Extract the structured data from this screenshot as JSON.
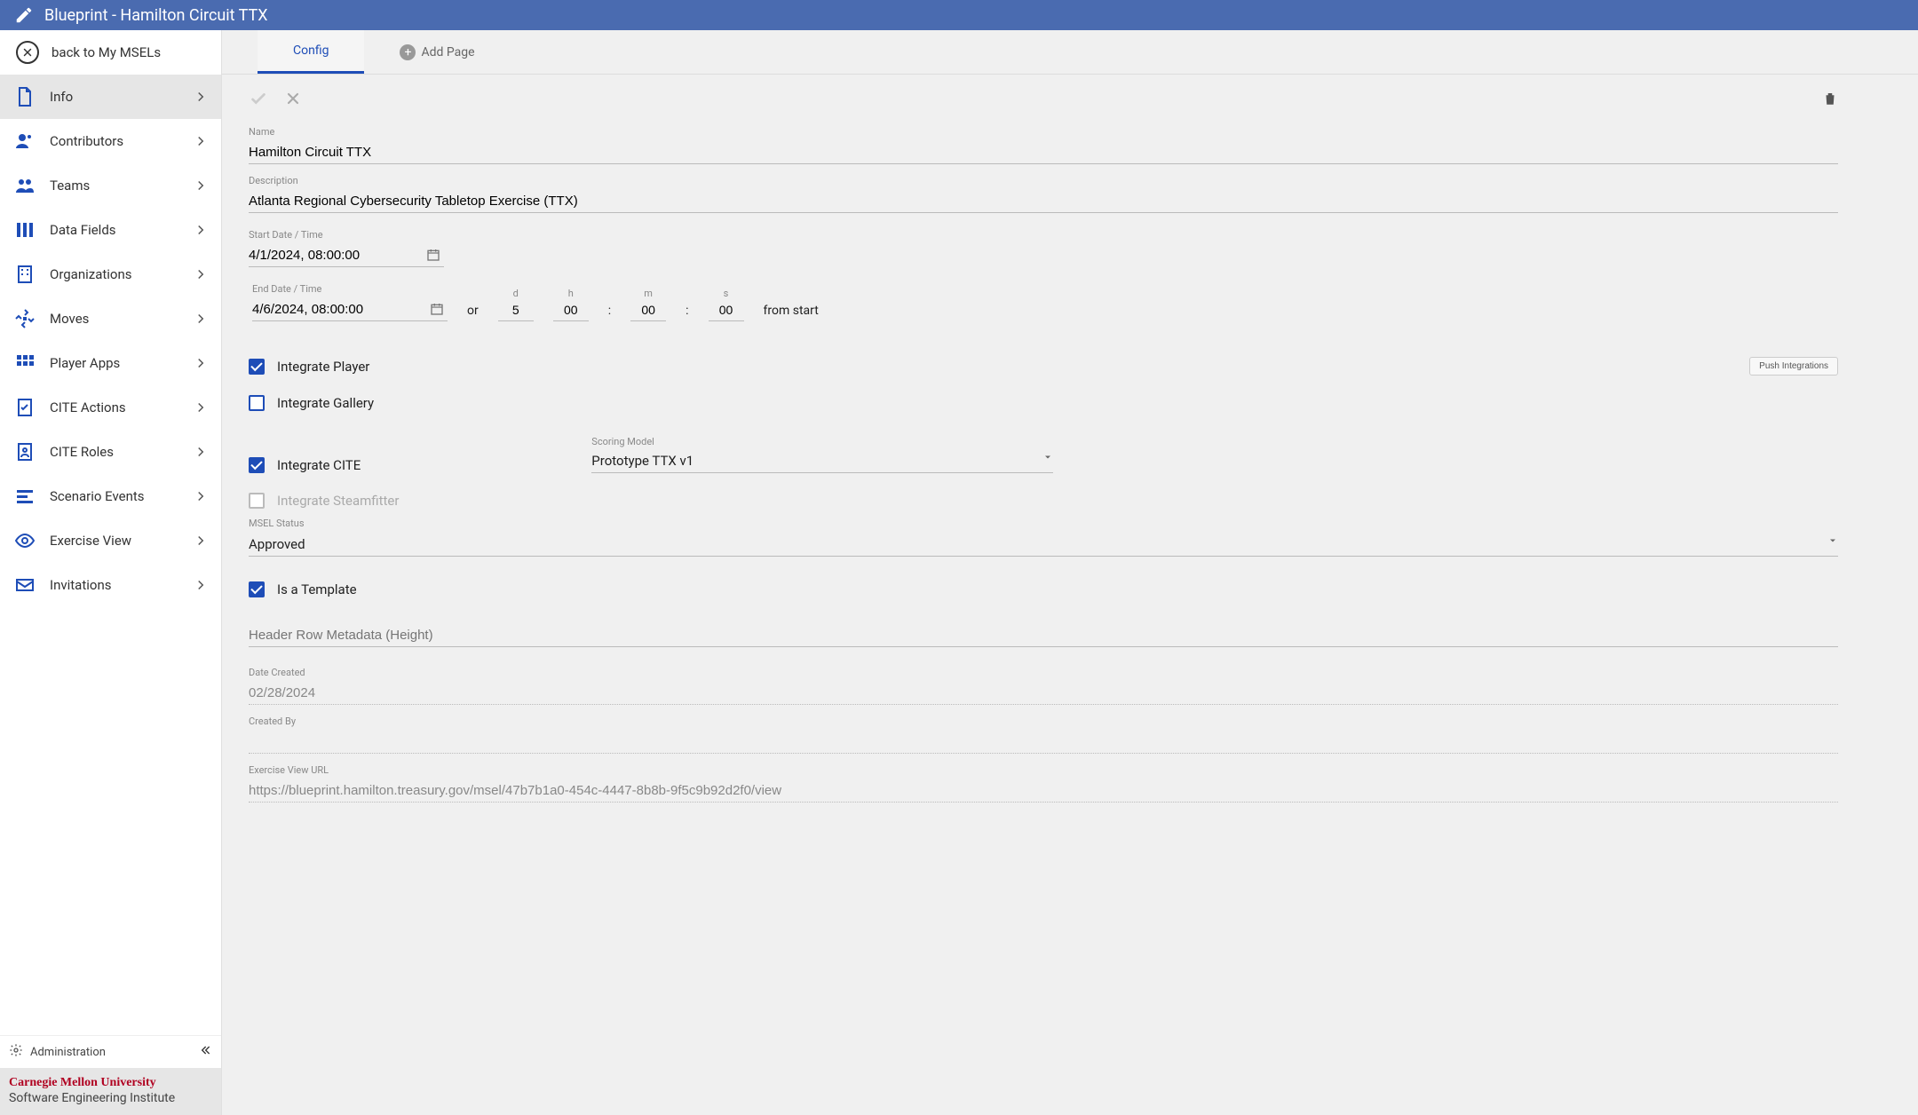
{
  "header": {
    "title": "Blueprint - Hamilton Circuit TTX"
  },
  "sidebar": {
    "back_label": "back to My MSELs",
    "items": [
      {
        "key": "info",
        "label": "Info",
        "active": true
      },
      {
        "key": "contributors",
        "label": "Contributors"
      },
      {
        "key": "teams",
        "label": "Teams"
      },
      {
        "key": "datafields",
        "label": "Data Fields"
      },
      {
        "key": "organizations",
        "label": "Organizations"
      },
      {
        "key": "moves",
        "label": "Moves"
      },
      {
        "key": "playerapps",
        "label": "Player Apps"
      },
      {
        "key": "citeactions",
        "label": "CITE Actions"
      },
      {
        "key": "citeroles",
        "label": "CITE Roles"
      },
      {
        "key": "scenarioevents",
        "label": "Scenario Events"
      },
      {
        "key": "exerciseview",
        "label": "Exercise View"
      },
      {
        "key": "invitations",
        "label": "Invitations"
      }
    ],
    "admin_label": "Administration",
    "brand_line1": "Carnegie Mellon University",
    "brand_line2": "Software Engineering Institute"
  },
  "tabs": {
    "config_label": "Config",
    "add_page_label": "Add Page"
  },
  "form": {
    "name_label": "Name",
    "name_value": "Hamilton Circuit TTX",
    "desc_label": "Description",
    "desc_value": "Atlanta Regional Cybersecurity Tabletop Exercise (TTX)",
    "start_label": "Start Date / Time",
    "start_value": "4/1/2024, 08:00:00",
    "end_label": "End Date / Time",
    "end_value": "4/6/2024, 08:00:00",
    "or_label": "or",
    "d_label": "d",
    "d_value": "5",
    "h_label": "h",
    "h_value": "00",
    "m_label": "m",
    "m_value": "00",
    "s_label": "s",
    "s_value": "00",
    "from_start_label": "from start",
    "integrate_player_label": "Integrate Player",
    "integrate_gallery_label": "Integrate Gallery",
    "integrate_cite_label": "Integrate CITE",
    "integrate_steamfitter_label": "Integrate Steamfitter",
    "push_integrations_label": "Push Integrations",
    "scoring_model_label": "Scoring Model",
    "scoring_model_value": "Prototype TTX v1",
    "msel_status_label": "MSEL Status",
    "msel_status_value": "Approved",
    "is_template_label": "Is a Template",
    "header_meta_placeholder": "Header Row Metadata (Height)",
    "date_created_label": "Date Created",
    "date_created_value": "02/28/2024",
    "created_by_label": "Created By",
    "created_by_value": "",
    "exercise_url_label": "Exercise View URL",
    "exercise_url_value": "https://blueprint.hamilton.treasury.gov/msel/47b7b1a0-454c-4447-8b8b-9f5c9b92d2f0/view"
  }
}
